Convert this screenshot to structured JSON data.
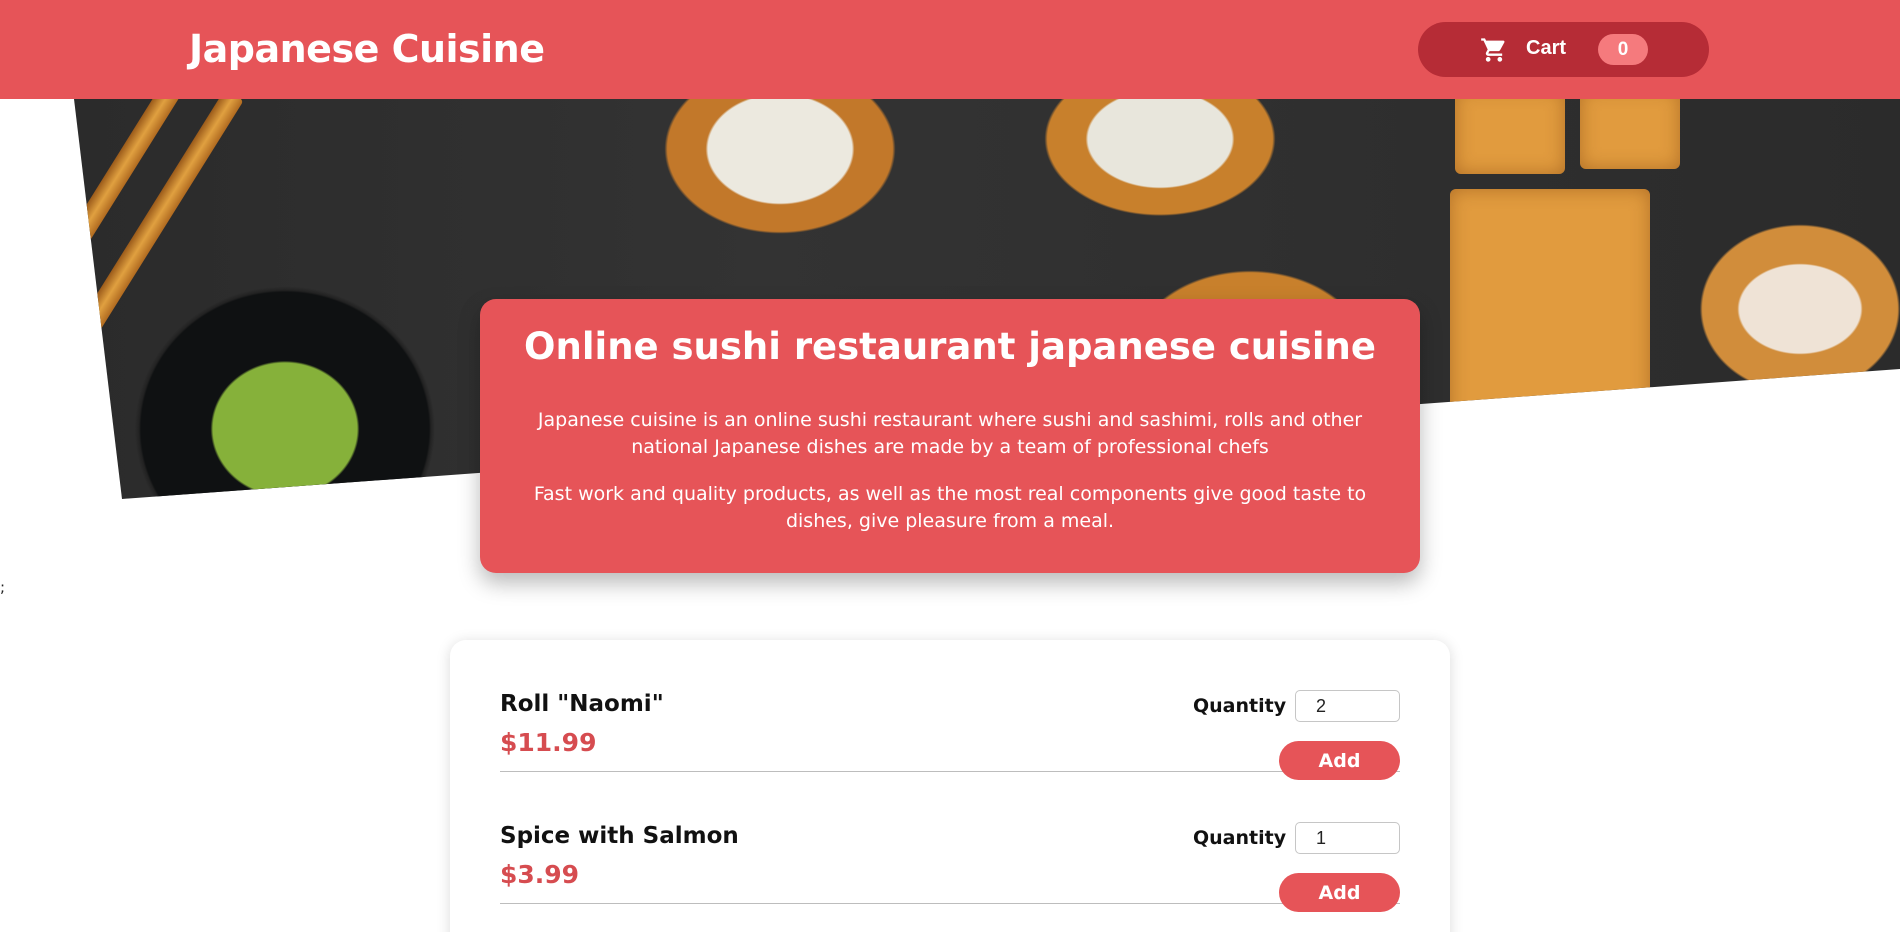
{
  "header": {
    "title": "Japanese Cuisine",
    "cart": {
      "label": "Cart",
      "count": "0",
      "icon": "cart-icon"
    }
  },
  "hero": {
    "title": "Online sushi restaurant japanese cuisine",
    "paragraph_1": "Japanese cuisine is an online sushi restaurant where sushi and sashimi, rolls and other national Japanese dishes are made by a team of professional chefs",
    "paragraph_2": "Fast work and quality products, as well as the most real components give good taste to dishes, give pleasure from a meal."
  },
  "stray_text": ";",
  "meals": [
    {
      "name": "Roll \"Naomi\"",
      "price": "$11.99",
      "quantity_label": "Quantity",
      "quantity": "2",
      "add_label": "Add"
    },
    {
      "name": "Spice with Salmon",
      "price": "$3.99",
      "quantity_label": "Quantity",
      "quantity": "1",
      "add_label": "Add"
    }
  ],
  "colors": {
    "primary": "#e65458",
    "cart_button": "#b62c36",
    "badge": "#f57a7d",
    "price": "#d64c50"
  }
}
